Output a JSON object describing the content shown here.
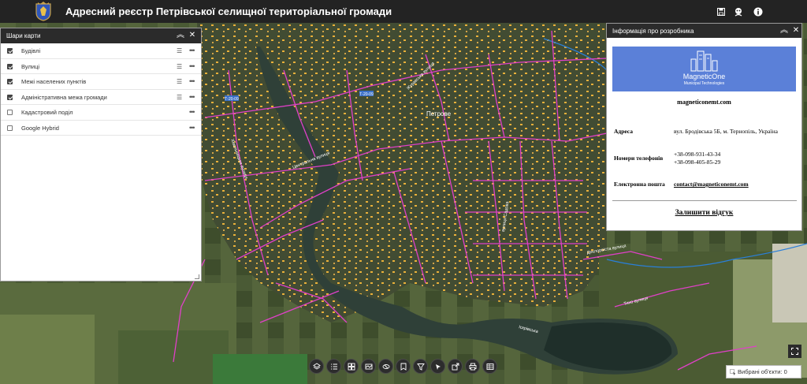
{
  "header": {
    "title": "Адресний реєстр Петрівської селищної територіальної громади",
    "icons": [
      "crest-logo",
      "save-icon",
      "face-icon",
      "info-icon"
    ]
  },
  "map": {
    "labels": {
      "town": "Петрове",
      "road_badge_1": "Т-20-09",
      "road_badge_2": "Т-20-09",
      "street_1": "Центральна вулиця",
      "street_2": "вулиця Садова",
      "street_3": "Деклорвіста вулиця",
      "street_4": "Іскрівська",
      "street_5": "Хмельницька вулиця",
      "street_6": "Тихо вулиця",
      "street_7": "Журавська вулиця"
    },
    "colors": {
      "satellite_bg": "#3d4a2e",
      "water": "#2f4038",
      "streets": "#e040c8",
      "buildings": "#f2b53a",
      "boundary": "#2a7fd8"
    }
  },
  "layers_panel": {
    "title": "Шари карти",
    "layers": [
      {
        "label": "Будівлі",
        "checked": true,
        "legend": true
      },
      {
        "label": "Вулиці",
        "checked": true,
        "legend": true
      },
      {
        "label": "Межі населених пунктів",
        "checked": true,
        "legend": true
      },
      {
        "label": "Адміністративна межа громади",
        "checked": true,
        "legend": true
      },
      {
        "label": "Кадастровий поділ",
        "checked": false,
        "legend": false
      },
      {
        "label": "Google Hybrid",
        "checked": false,
        "legend": false
      }
    ]
  },
  "info_panel": {
    "title": "Інформація про розробника",
    "logo_line1": "MagneticOne",
    "logo_line2": "Municipal Technologies",
    "website": "magneticonemt.com",
    "address_label": "Адреса",
    "address_value": "вул. Бродівська 5Б, м. Тернопіль, Україна",
    "phones_label": "Номери телефонів",
    "phone_1": "+38-098-931-43-34",
    "phone_2": "+38-098-405-85-29",
    "email_label": "Електронна пошта",
    "email_value": "contact@magneticonemt.com",
    "feedback_label": "Залишити відгук"
  },
  "toolbar": {
    "buttons": [
      "layers-icon",
      "list-icon",
      "grid-icon",
      "basemap-icon",
      "measure-icon",
      "bookmark-icon",
      "filter-icon",
      "select-icon",
      "share-icon",
      "print-icon",
      "table-icon"
    ]
  },
  "status": {
    "selected_label": "Вибрані об'єкти: 0"
  }
}
